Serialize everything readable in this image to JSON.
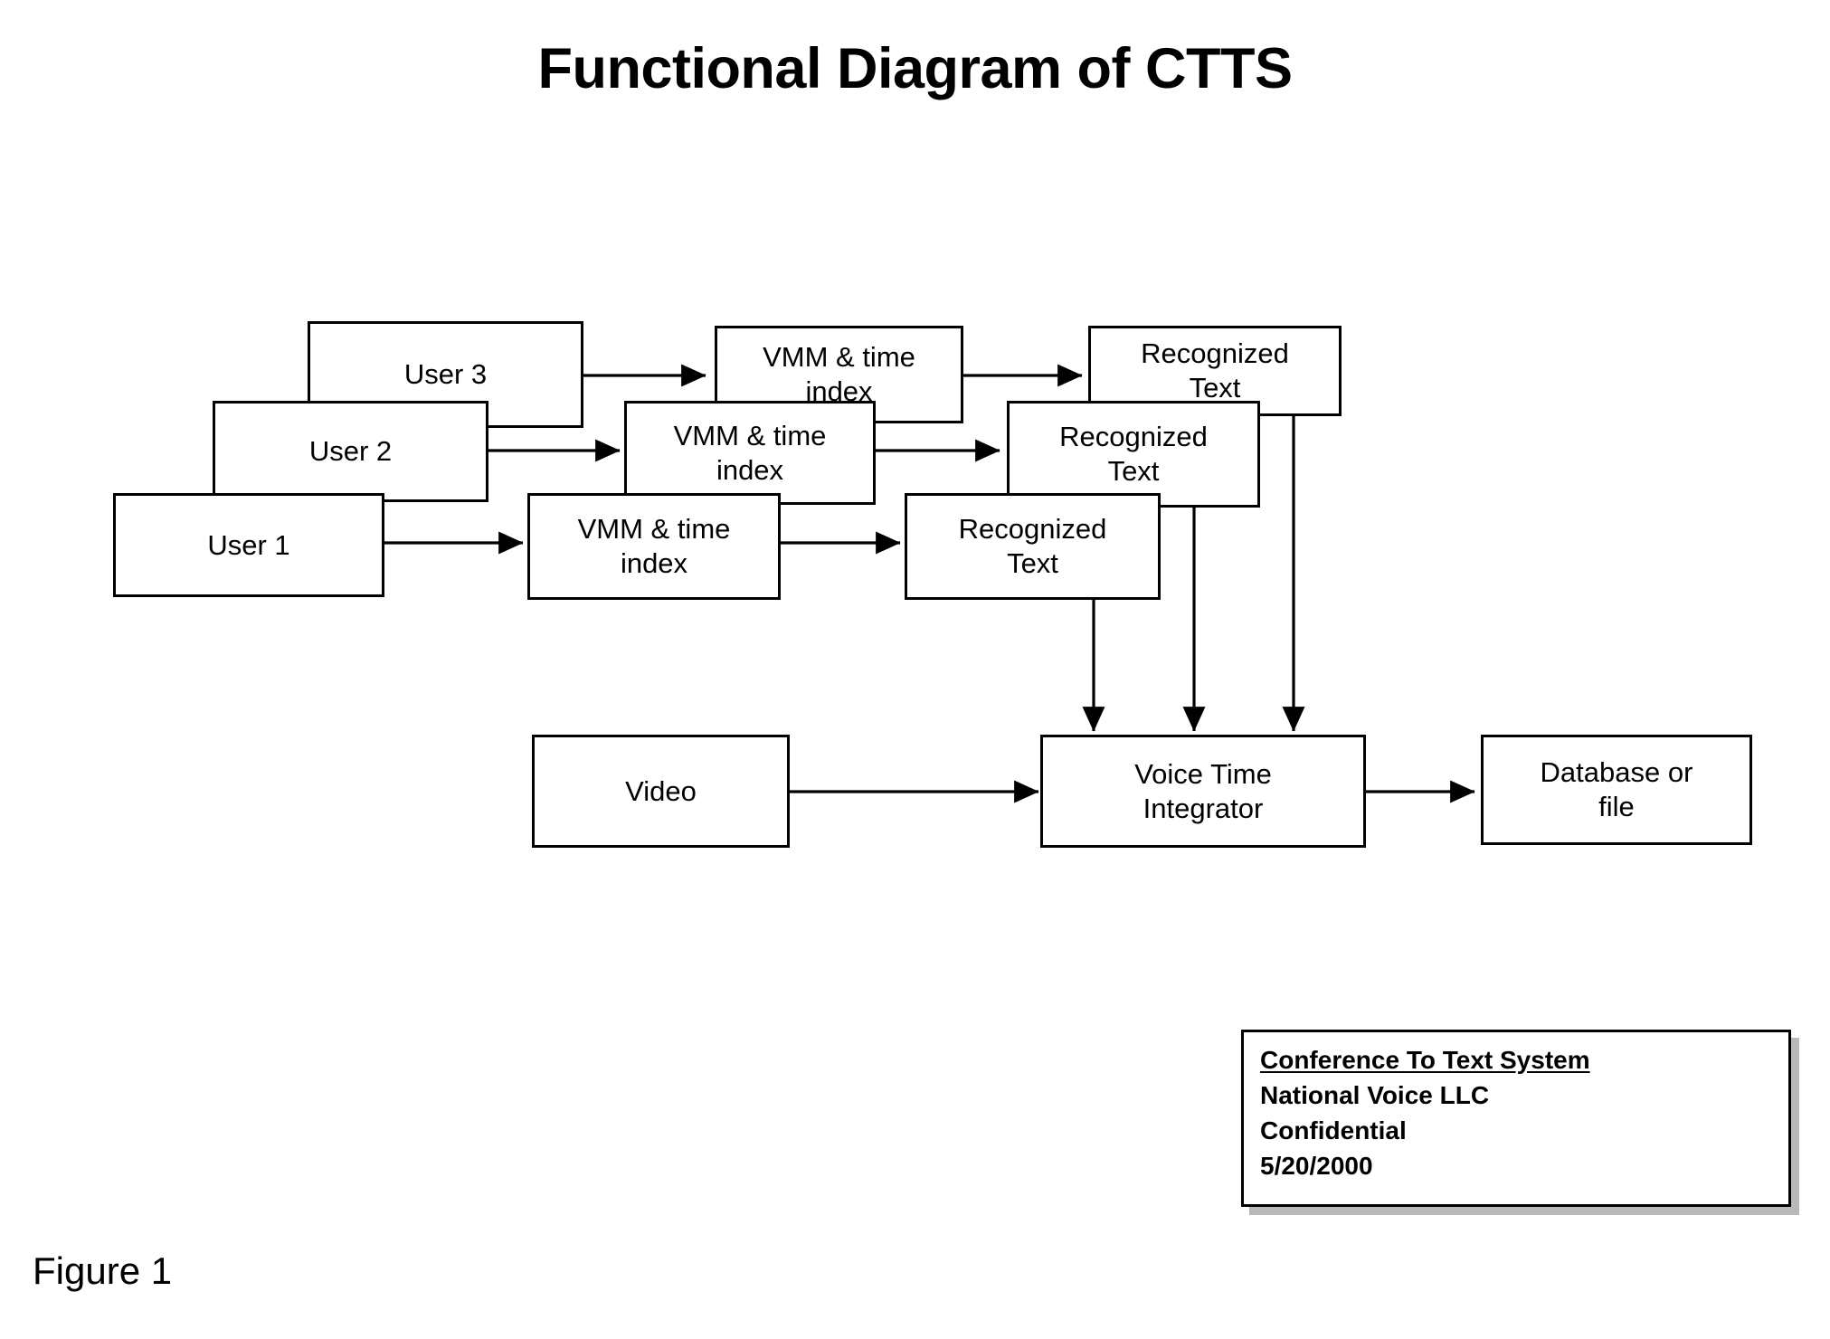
{
  "title": "Functional Diagram of CTTS",
  "figure_caption": "Figure 1",
  "colors": {
    "stroke": "#000000",
    "fill": "#ffffff",
    "shadow": "#b9b9b9"
  },
  "nodes": {
    "user3": "User 3",
    "user2": "User 2",
    "user1": "User 1",
    "vmm3": "VMM & time\nindex",
    "vmm2": "VMM & time\nindex",
    "vmm1": "VMM & time\nindex",
    "rec3": "Recognized\nText",
    "rec2": "Recognized\nText",
    "rec1": "Recognized\nText",
    "video": "Video",
    "integrator": "Voice Time\nIntegrator",
    "database": "Database or\nfile"
  },
  "legend": {
    "title": "Conference To Text System",
    "company": "National Voice LLC",
    "classification": "Confidential",
    "date": "5/20/2000"
  },
  "flows": [
    {
      "from": "user3",
      "to": "vmm3"
    },
    {
      "from": "vmm3",
      "to": "rec3"
    },
    {
      "from": "user2",
      "to": "vmm2"
    },
    {
      "from": "vmm2",
      "to": "rec2"
    },
    {
      "from": "user1",
      "to": "vmm1"
    },
    {
      "from": "vmm1",
      "to": "rec1"
    },
    {
      "from": "rec1",
      "to": "integrator"
    },
    {
      "from": "rec2",
      "to": "integrator"
    },
    {
      "from": "rec3",
      "to": "integrator"
    },
    {
      "from": "video",
      "to": "integrator"
    },
    {
      "from": "integrator",
      "to": "database"
    }
  ]
}
